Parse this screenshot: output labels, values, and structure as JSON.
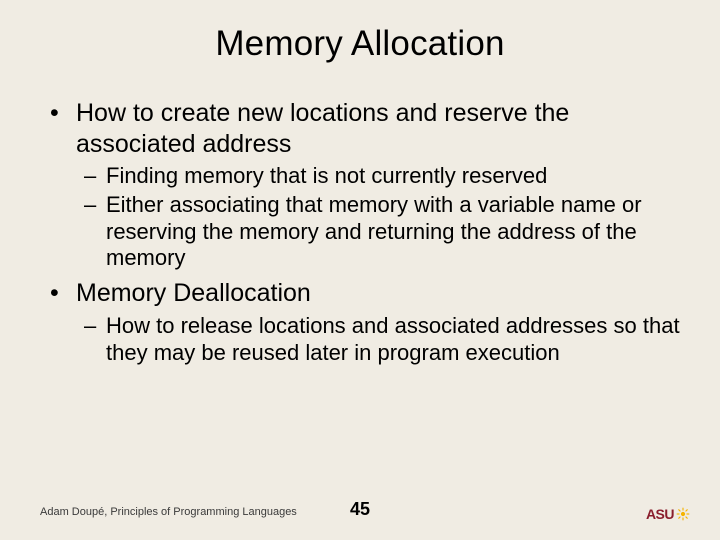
{
  "title": "Memory Allocation",
  "bullets": {
    "b1": "How to create new locations and reserve the associated address",
    "b1a": "Finding memory that is not currently reserved",
    "b1b": "Either associating that memory with a variable name or reserving the memory and returning the address of the memory",
    "b2": "Memory Deallocation",
    "b2a": "How to release locations and associated addresses so that they may be reused later in program execution"
  },
  "footer": "Adam Doupé, Principles of Programming Languages",
  "page": "45",
  "logo_text": "ASU"
}
